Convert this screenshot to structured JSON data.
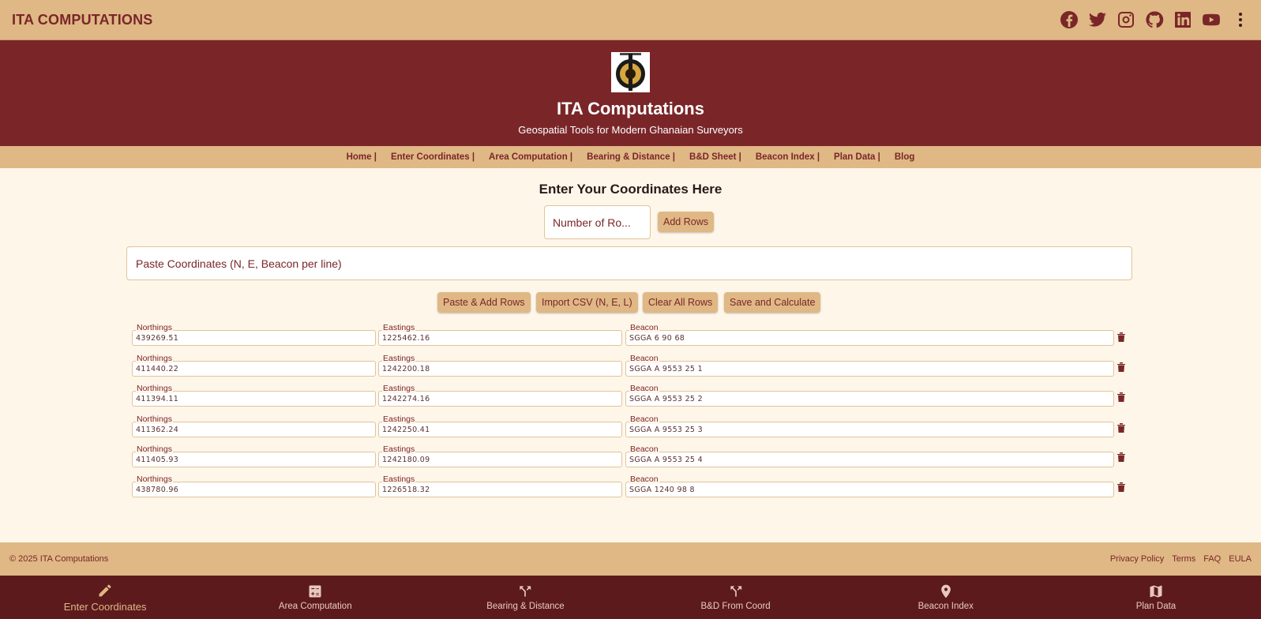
{
  "appbar": {
    "title": "ITA COMPUTATIONS",
    "icons": [
      "facebook-icon",
      "twitter-icon",
      "instagram-icon",
      "github-icon",
      "linkedin-icon",
      "youtube-icon",
      "more-vert-icon"
    ]
  },
  "hero": {
    "title": "ITA Computations",
    "subtitle": "Geospatial Tools for Modern Ghanaian Surveyors"
  },
  "nav": {
    "items": [
      "Home |",
      "Enter Coordinates |",
      "Area Computation |",
      "Bearing & Distance |",
      "B&D Sheet |",
      "Beacon Index |",
      "Plan Data |",
      "Blog"
    ]
  },
  "main": {
    "title": "Enter Your Coordinates Here",
    "rows_placeholder": "Number of Ro...",
    "add_rows_label": "Add Rows",
    "paste_placeholder": "Paste Coordinates (N, E, Beacon per line)",
    "buttons": {
      "paste_add": "Paste & Add Rows",
      "import_csv": "Import CSV (N, E, L)",
      "clear_all": "Clear All Rows",
      "save_calc": "Save and Calculate"
    },
    "field_labels": {
      "northings": "Northings",
      "eastings": "Eastings",
      "beacon": "Beacon"
    },
    "rows": [
      {
        "northing": "439269.51",
        "easting": "1225462.16",
        "beacon": "SGGA 6 90 68"
      },
      {
        "northing": "411440.22",
        "easting": "1242200.18",
        "beacon": "SGGA A 9553 25 1"
      },
      {
        "northing": "411394.11",
        "easting": "1242274.16",
        "beacon": "SGGA A 9553 25 2"
      },
      {
        "northing": "411362.24",
        "easting": "1242250.41",
        "beacon": "SGGA A 9553 25 3"
      },
      {
        "northing": "411405.93",
        "easting": "1242180.09",
        "beacon": "SGGA A 9553 25 4"
      },
      {
        "northing": "438780.96",
        "easting": "1226518.32",
        "beacon": "SGGA 1240 98 8"
      }
    ]
  },
  "footer": {
    "copyright": "© 2025 ITA Computations",
    "links": [
      "Privacy Policy",
      "Terms",
      "FAQ",
      "EULA"
    ]
  },
  "bottom_nav": {
    "items": [
      {
        "label": "Enter Coordinates",
        "icon": "pencil-icon",
        "active": true
      },
      {
        "label": "Area Computation",
        "icon": "calculator-icon",
        "active": false
      },
      {
        "label": "Bearing & Distance",
        "icon": "fork-icon",
        "active": false
      },
      {
        "label": "B&D From Coord",
        "icon": "fork-icon",
        "active": false
      },
      {
        "label": "Beacon Index",
        "icon": "location-pin-icon",
        "active": false
      },
      {
        "label": "Plan Data",
        "icon": "map-icon",
        "active": false
      }
    ]
  },
  "colors": {
    "primary": "#7a2628",
    "accent": "#dfb885",
    "background": "#fff6ea",
    "bottom_nav": "#5c1a1d"
  }
}
